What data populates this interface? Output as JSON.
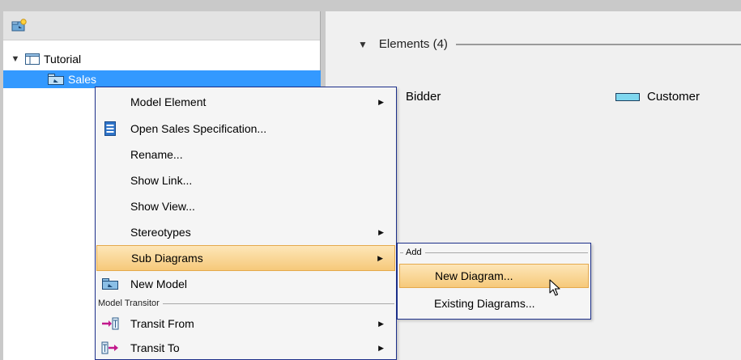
{
  "tree": {
    "items": [
      {
        "label": "Tutorial",
        "icon": "model-icon",
        "expanded": true
      },
      {
        "label": "Sales",
        "icon": "package-icon",
        "selected": true
      }
    ]
  },
  "elements": {
    "header": "Elements (4)",
    "items": [
      {
        "label": "Bidder"
      },
      {
        "label": "Customer",
        "icon": "class-icon"
      }
    ]
  },
  "context_menu": {
    "items": [
      {
        "label": "Model Element",
        "has_submenu": true
      },
      {
        "label": "Open Sales Specification...",
        "icon": "specification-icon"
      },
      {
        "label": "Rename..."
      },
      {
        "label": "Show Link..."
      },
      {
        "label": "Show View..."
      },
      {
        "label": "Stereotypes",
        "has_submenu": true
      },
      {
        "label": "Sub Diagrams",
        "has_submenu": true,
        "highlighted": true
      },
      {
        "label": "New Model",
        "icon": "new-model-icon"
      },
      {
        "label": "Transit From",
        "icon": "transit-from-icon",
        "has_submenu": true
      },
      {
        "label": "Transit To",
        "icon": "transit-to-icon",
        "has_submenu": true
      }
    ],
    "section_label": "Model Transitor"
  },
  "submenu": {
    "section_label": "Add",
    "items": [
      {
        "label": "New Diagram...",
        "highlighted": true
      },
      {
        "label": "Existing Diagrams..."
      }
    ]
  },
  "colors": {
    "selection": "#3399ff",
    "menu_highlight": "#f6c97a",
    "menu_border": "#1c2f8a"
  }
}
